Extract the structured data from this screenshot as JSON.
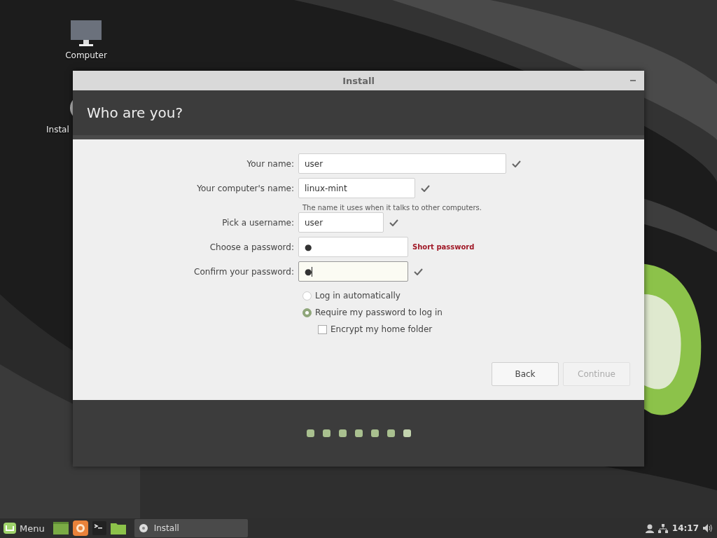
{
  "desktop_icons": [
    {
      "kind": "computer",
      "label": "Computer"
    },
    {
      "kind": "disc",
      "label": "Instal"
    }
  ],
  "window": {
    "title": "Install",
    "heading": "Who are you?",
    "fields": [
      {
        "label": "Your name:",
        "value": "user",
        "valid": true,
        "focused": false
      },
      {
        "label": "Your computer's name:",
        "value": "linux-mint",
        "valid": true,
        "focused": false,
        "hint": "The name it uses when it talks to other computers."
      },
      {
        "label": "Pick a username:",
        "value": "user",
        "valid": true,
        "focused": false
      },
      {
        "label": "Choose a password:",
        "value": "●",
        "valid": false,
        "focused": false,
        "status": "Short password"
      },
      {
        "label": "Confirm your password:",
        "value": "●",
        "valid": true,
        "focused": true
      }
    ],
    "login_options": [
      {
        "label": "Log in automatically",
        "selected": false
      },
      {
        "label": "Require my password to log in",
        "selected": true
      }
    ],
    "encrypt": {
      "label": "Encrypt my home folder",
      "checked": false
    },
    "buttons": [
      {
        "label": "Back",
        "disabled": false
      },
      {
        "label": "Continue",
        "disabled": true
      }
    ],
    "steps": [
      {
        "current": false
      },
      {
        "current": false
      },
      {
        "current": false
      },
      {
        "current": false
      },
      {
        "current": false
      },
      {
        "current": false
      },
      {
        "current": true
      }
    ]
  },
  "taskbar": {
    "menu": "Menu",
    "launchers": [
      {
        "kind": "desktop"
      },
      {
        "kind": "browser"
      },
      {
        "kind": "terminal"
      },
      {
        "kind": "folder"
      }
    ],
    "tasks": [
      {
        "label": "Install",
        "selected": true
      }
    ],
    "clock": "14:17"
  }
}
